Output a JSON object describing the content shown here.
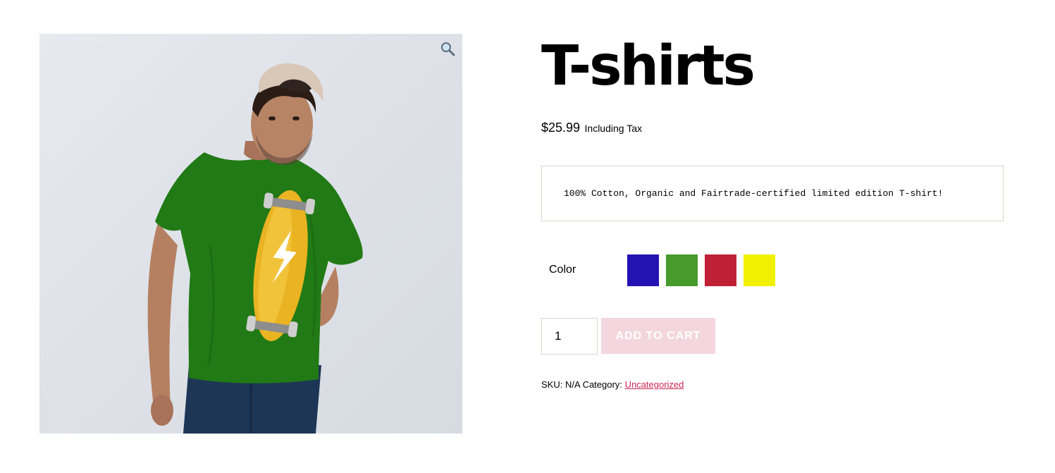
{
  "product": {
    "title": "T-shirts",
    "price": "$25.99",
    "price_suffix": "Including Tax",
    "description": "100% Cotton, Organic and Fairtrade-certified limited edition T-shirt!",
    "image": {
      "zoom_icon": "magnifier-icon",
      "shirt_color": "#217a15",
      "background": "#e1e5eb"
    }
  },
  "variations": {
    "label": "Color",
    "swatches": [
      {
        "name": "Blue",
        "color": "#2213b2"
      },
      {
        "name": "Green",
        "color": "#479a2c"
      },
      {
        "name": "Red",
        "color": "#bf2035"
      },
      {
        "name": "Yellow",
        "color": "#f0f000"
      }
    ]
  },
  "cart": {
    "quantity": "1",
    "button_label": "ADD TO CART",
    "button_color": "#f4d6df"
  },
  "meta": {
    "sku_label": "SKU:",
    "sku_value": "N/A",
    "category_label": "Category:",
    "category_value": "Uncategorized",
    "link_color": "#cd2653"
  }
}
